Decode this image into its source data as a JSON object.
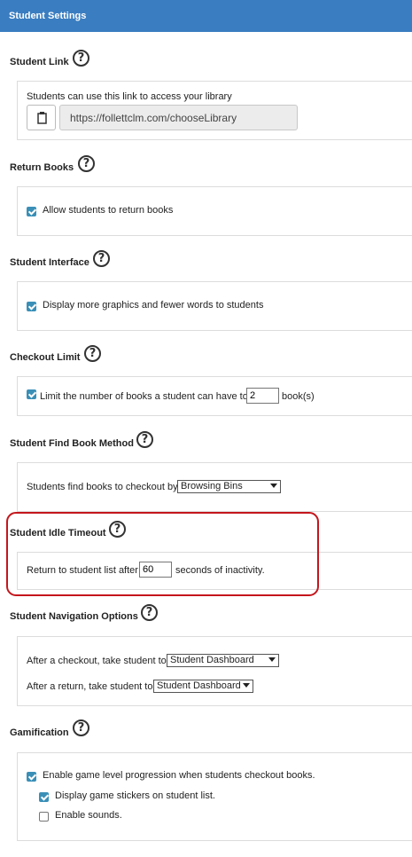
{
  "header": {
    "title": "Student Settings"
  },
  "student_link": {
    "title": "Student Link",
    "description": "Students can use this link to access your library",
    "url": "https://follettclm.com/chooseLibrary"
  },
  "return_books": {
    "title": "Return Books",
    "option": "Allow students to return books",
    "checked": true
  },
  "student_interface": {
    "title": "Student Interface",
    "option": "Display more graphics and fewer words to students",
    "checked": true
  },
  "checkout_limit": {
    "title": "Checkout Limit",
    "prefix": "Limit the number of books a student can have to",
    "value": "2",
    "suffix": "book(s)",
    "checked": true
  },
  "find_book": {
    "title": "Student Find Book Method",
    "label": "Students find books to checkout by",
    "selected": "Browsing Bins"
  },
  "idle_timeout": {
    "title": "Student Idle Timeout",
    "prefix": "Return to student list after",
    "value": "60",
    "suffix": "seconds of inactivity."
  },
  "navigation": {
    "title": "Student Navigation Options",
    "after_checkout_label": "After a checkout, take student to",
    "after_checkout_value": "Student Dashboard",
    "after_return_label": "After a return, take student to",
    "after_return_value": "Student Dashboard"
  },
  "gamification": {
    "title": "Gamification",
    "progression": "Enable game level progression when students checkout books.",
    "stickers": "Display game stickers on student list.",
    "sounds": "Enable sounds.",
    "progression_checked": true,
    "stickers_checked": true,
    "sounds_checked": false
  },
  "icons": {
    "help": "?",
    "help_icon": "question-circle-icon",
    "clipboard_icon": "clipboard-icon"
  },
  "colors": {
    "header_bg": "#3a7dc0",
    "checkbox": "#3a8fb7",
    "highlight": "#c4161c"
  }
}
